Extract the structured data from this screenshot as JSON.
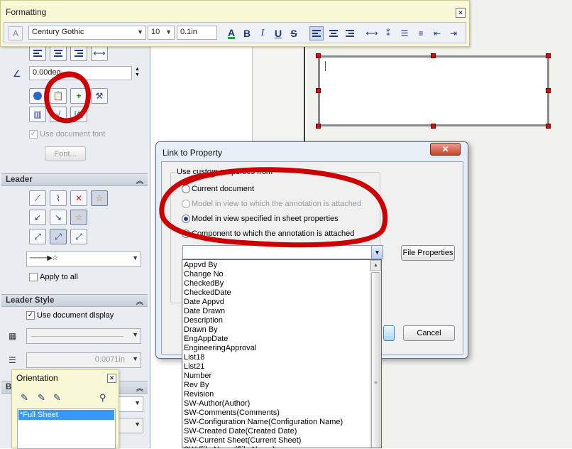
{
  "formatting": {
    "title": "Formatting",
    "font": "Century Gothic",
    "size": "10",
    "height": "0.1in"
  },
  "left_panel": {
    "angle_value": "0.00deg",
    "use_document_font": "Use document font",
    "font_button": "Font...",
    "leader_header": "Leader",
    "apply_to_all": "Apply to all",
    "leader_style_header": "Leader Style",
    "use_document_display": "Use document display",
    "line_weight": "0.0071in",
    "partial_header_letter": "B"
  },
  "dialog": {
    "title": "Link to Property",
    "group_label": "Use custom properties from",
    "options": [
      "Current document",
      "Model in view to which the annotation is attached",
      "Model in view specified in sheet properties",
      "Component to which the annotation is attached"
    ],
    "selected_option": "Model in view specified in sheet properties",
    "combo_value": "",
    "file_properties": "File Properties",
    "cancel": "Cancel"
  },
  "property_list": [
    "Appvd By",
    "Change No",
    "CheckedBy",
    "CheckedDate",
    "Date Appvd",
    "Date Drawn",
    "Description",
    "Drawn By",
    "EngAppDate",
    "EngineeringApproval",
    "List18",
    "List21",
    "Number",
    "Rev By",
    "Revision",
    "SW-Author(Author)",
    "SW-Comments(Comments)",
    "SW-Configuration Name(Configuration Name)",
    "SW-Created Date(Created Date)",
    "SW-Current Sheet(Current Sheet)",
    "SW-File Name(File Name)"
  ],
  "orientation": {
    "title": "Orientation",
    "items": [
      "*Full Sheet"
    ]
  },
  "colors": {
    "annotation_red": "#cc0000",
    "selection_blue": "#3399ff",
    "toolbar_yellow": "#f8f8d6"
  }
}
